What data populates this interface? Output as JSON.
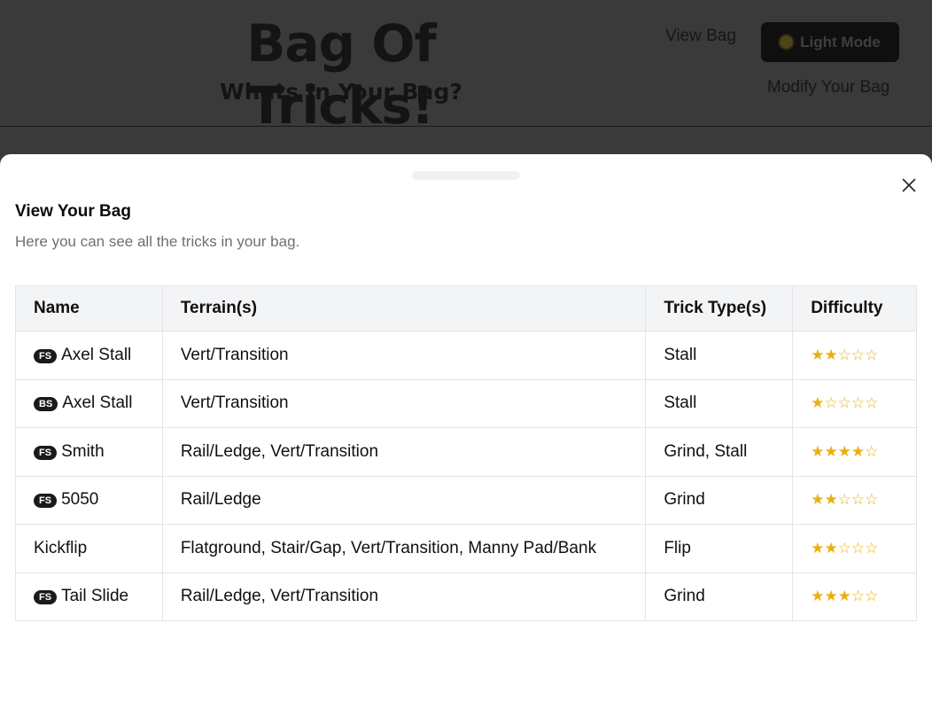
{
  "header": {
    "title": "Bag Of Tricks!",
    "subtitle": "Whats In Your Bag?",
    "nav_view": "View Bag",
    "nav_modify": "Modify Your Bag",
    "mode_button": "Light Mode",
    "mode_icon": "sun-icon"
  },
  "modal": {
    "title": "View Your Bag",
    "description": "Here you can see all the tricks in your bag.",
    "close_icon": "close-icon"
  },
  "table": {
    "headers": [
      "Name",
      "Terrain(s)",
      "Trick Type(s)",
      "Difficulty"
    ],
    "rows": [
      {
        "badge": "FS",
        "name": "Axel Stall",
        "terrain": "Vert/Transition",
        "type": "Stall",
        "difficulty": 2,
        "stars": "★★☆☆☆"
      },
      {
        "badge": "BS",
        "name": "Axel Stall",
        "terrain": "Vert/Transition",
        "type": "Stall",
        "difficulty": 1,
        "stars": "★☆☆☆☆"
      },
      {
        "badge": "FS",
        "name": "Smith",
        "terrain": "Rail/Ledge, Vert/Transition",
        "type": "Grind, Stall",
        "difficulty": 4,
        "stars": "★★★★☆"
      },
      {
        "badge": "FS",
        "name": "5050",
        "terrain": "Rail/Ledge",
        "type": "Grind",
        "difficulty": 2,
        "stars": "★★☆☆☆"
      },
      {
        "badge": "",
        "name": "Kickflip",
        "terrain": "Flatground, Stair/Gap, Vert/Transition, Manny Pad/Bank",
        "type": "Flip",
        "difficulty": 2,
        "stars": "★★☆☆☆"
      },
      {
        "badge": "FS",
        "name": "Tail Slide",
        "terrain": "Rail/Ledge, Vert/Transition",
        "type": "Grind",
        "difficulty": 3,
        "stars": "★★★☆☆"
      }
    ]
  },
  "colors": {
    "star": "#e8b010",
    "badge_bg": "#1a1a1a",
    "header_bg": "#f3f4f6"
  }
}
